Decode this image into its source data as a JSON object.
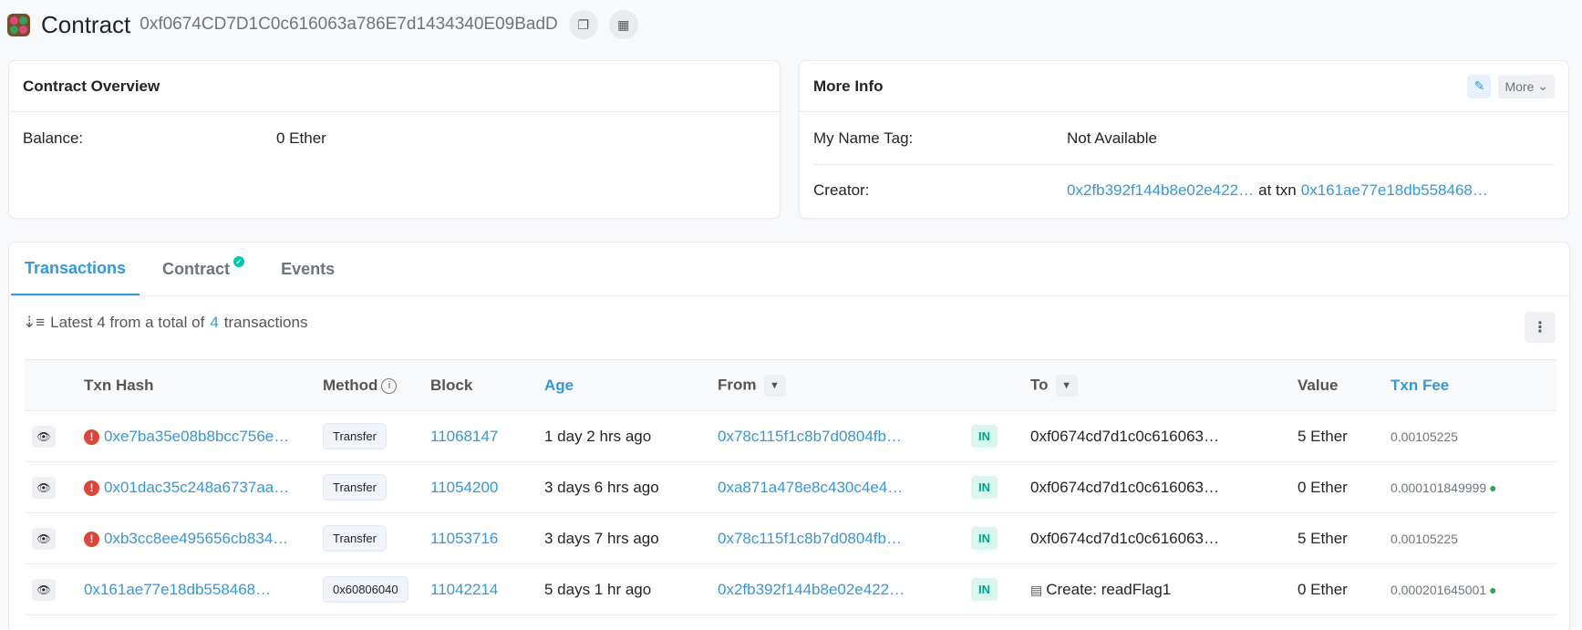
{
  "header": {
    "title": "Contract",
    "address": "0xf0674CD7D1C0c616063a786E7d1434340E09BadD"
  },
  "overview": {
    "title": "Contract Overview",
    "balance_label": "Balance:",
    "balance_value": "0 Ether"
  },
  "more_info": {
    "title": "More Info",
    "more_label": "More",
    "name_tag_label": "My Name Tag:",
    "name_tag_value": "Not Available",
    "creator_label": "Creator:",
    "creator_address": "0x2fb392f144b8e02e422…",
    "at_txn": "at txn",
    "creator_txn": "0x161ae77e18db558468…"
  },
  "tabs": [
    "Transactions",
    "Contract",
    "Events"
  ],
  "summary": {
    "prefix": "Latest 4 from a total of",
    "count": "4",
    "suffix": "transactions"
  },
  "columns": {
    "hash": "Txn Hash",
    "method": "Method",
    "block": "Block",
    "age": "Age",
    "from": "From",
    "to": "To",
    "value": "Value",
    "fee": "Txn Fee"
  },
  "rows": [
    {
      "hash": "0xe7ba35e08b8bcc756e…",
      "method": "Transfer",
      "block": "11068147",
      "age": "1 day 2 hrs ago",
      "from": "0x78c115f1c8b7d0804fb…",
      "dir": "IN",
      "to": "0xf0674cd7d1c0c616063…",
      "value": "5 Ether",
      "fee": "0.00105225"
    },
    {
      "hash": "0x01dac35c248a6737aa…",
      "method": "Transfer",
      "block": "11054200",
      "age": "3 days 6 hrs ago",
      "from": "0xa871a478e8c430c4e4…",
      "dir": "IN",
      "to": "0xf0674cd7d1c0c616063…",
      "value": "0 Ether",
      "fee": "0.000101849999"
    },
    {
      "hash": "0xb3cc8ee495656cb834…",
      "method": "Transfer",
      "block": "11053716",
      "age": "3 days 7 hrs ago",
      "from": "0x78c115f1c8b7d0804fb…",
      "dir": "IN",
      "to": "0xf0674cd7d1c0c616063…",
      "value": "5 Ether",
      "fee": "0.00105225"
    },
    {
      "hash": "0x161ae77e18db558468…",
      "method": "0x60806040",
      "block": "11042214",
      "age": "5 days 1 hr ago",
      "from": "0x2fb392f144b8e02e422…",
      "dir": "IN",
      "to": "Create: readFlag1",
      "value": "0 Ether",
      "fee": "0.000201645001"
    }
  ]
}
